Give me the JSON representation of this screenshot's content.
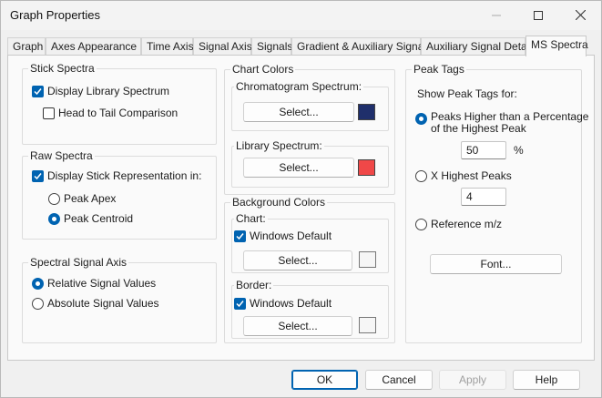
{
  "window": {
    "title": "Graph Properties",
    "controls": {
      "minimize": "—",
      "maximize": "☐",
      "close": "✕"
    }
  },
  "tabs": [
    {
      "label": "Graph"
    },
    {
      "label": "Axes Appearance"
    },
    {
      "label": "Time Axis"
    },
    {
      "label": "Signal Axis"
    },
    {
      "label": "Signals"
    },
    {
      "label": "Gradient & Auxiliary Signals"
    },
    {
      "label": "Auxiliary Signal Details"
    },
    {
      "label": "MS Spectra",
      "active": true
    }
  ],
  "stick_spectra": {
    "label": "Stick Spectra",
    "display_library": {
      "label": "Display Library Spectrum",
      "checked": true
    },
    "head_to_tail": {
      "label": "Head to Tail Comparison",
      "checked": false
    }
  },
  "raw_spectra": {
    "label": "Raw Spectra",
    "display_stick": {
      "label": "Display Stick Representation in:",
      "checked": true
    },
    "peak_apex": {
      "label": "Peak Apex",
      "selected": false
    },
    "peak_centroid": {
      "label": "Peak Centroid",
      "selected": true
    }
  },
  "spectral_signal_axis": {
    "label": "Spectral Signal Axis",
    "relative": {
      "label": "Relative Signal Values",
      "selected": true
    },
    "absolute": {
      "label": "Absolute Signal Values",
      "selected": false
    }
  },
  "chart_colors": {
    "label": "Chart Colors",
    "chromatogram": {
      "label": "Chromatogram Spectrum:",
      "button": "Select...",
      "color": "#1f2f6b"
    },
    "library": {
      "label": "Library Spectrum:",
      "button": "Select...",
      "color": "#f04848"
    }
  },
  "background_colors": {
    "label": "Background Colors",
    "chart": {
      "label": "Chart:",
      "windows_default": "Windows Default",
      "checked": true,
      "button": "Select...",
      "color": "#f6f6f6"
    },
    "border": {
      "label": "Border:",
      "windows_default": "Windows Default",
      "checked": true,
      "button": "Select...",
      "color": "#f6f6f6"
    }
  },
  "peak_tags": {
    "label": "Peak Tags",
    "show_for": "Show Peak Tags for:",
    "higher_pct": {
      "label_line1": "Peaks Higher than a Percentage",
      "label_line2": "of the Highest Peak",
      "selected": true
    },
    "pct_value": "50",
    "pct_unit": "%",
    "x_highest": {
      "label": "X Highest Peaks",
      "selected": false
    },
    "x_value": "4",
    "reference_mz": {
      "label": "Reference m/z",
      "selected": false
    },
    "font_button": "Font..."
  },
  "footer": {
    "ok": "OK",
    "cancel": "Cancel",
    "apply": "Apply",
    "help": "Help"
  },
  "colors": {
    "accent": "#0063b1",
    "check_mark": "#ffffff"
  }
}
